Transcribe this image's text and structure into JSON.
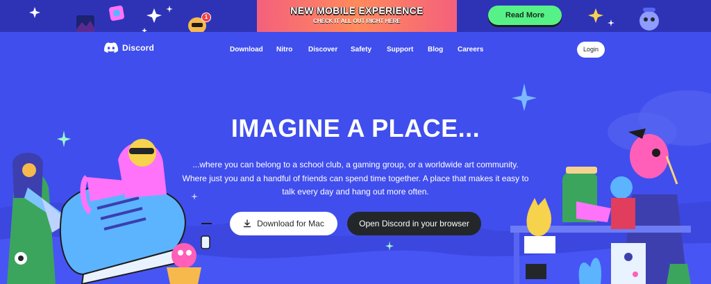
{
  "banner": {
    "title": "NEW MOBILE EXPERIENCE",
    "subtitle": "CHECK IT ALL OUT RIGHT HERE",
    "cta": "Read More",
    "notification_count": "1"
  },
  "nav": {
    "brand": "Discord",
    "links": [
      "Download",
      "Nitro",
      "Discover",
      "Safety",
      "Support",
      "Blog",
      "Careers"
    ],
    "login": "Login"
  },
  "hero": {
    "title": "IMAGINE A PLACE...",
    "description": "...where you can belong to a school club, a gaming group, or a worldwide art community. Where just you and a handful of friends can spend time together. A place that makes it easy to talk every day and hang out more often.",
    "download_button": "Download for Mac",
    "browser_button": "Open Discord in your browser"
  },
  "colors": {
    "blurple": "#404eed",
    "banner": "#2e33b6",
    "green": "#57f287",
    "dark": "#23272a"
  }
}
